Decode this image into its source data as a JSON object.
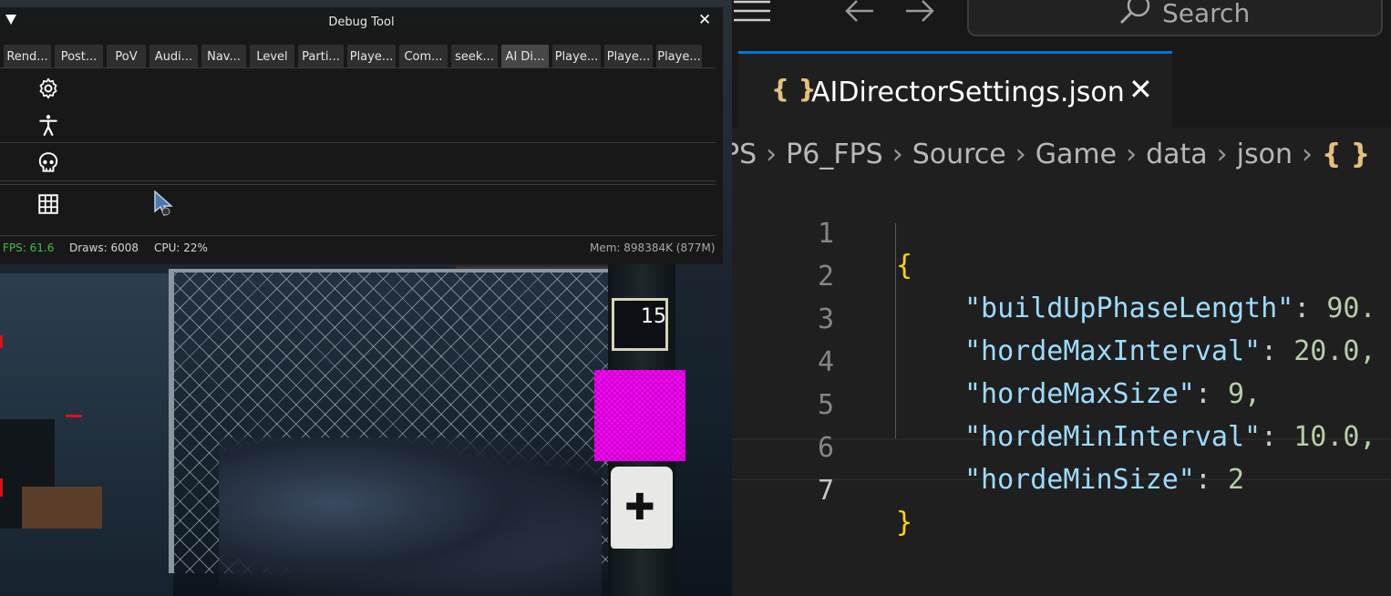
{
  "debug_tool": {
    "title": "Debug Tool",
    "close_glyph": "✕",
    "tabs": [
      {
        "label": "Rend..."
      },
      {
        "label": "Post..."
      },
      {
        "label": "PoV"
      },
      {
        "label": "Audi..."
      },
      {
        "label": "Nav..."
      },
      {
        "label": "Level"
      },
      {
        "label": "Parti..."
      },
      {
        "label": "Playe..."
      },
      {
        "label": "Com..."
      },
      {
        "label": "seek..."
      },
      {
        "label": "AI Di...",
        "active": true
      },
      {
        "label": "Playe..."
      },
      {
        "label": "Playe..."
      },
      {
        "label": "Playe..."
      }
    ],
    "side_icons": [
      "gear-icon",
      "person-icon",
      "skull-icon",
      "grid-icon"
    ],
    "status": {
      "fps": "FPS: 61.6",
      "draws": "Draws: 6008",
      "cpu": "CPU: 22%",
      "mem": "Mem: 898384K (877M)"
    },
    "colors": {
      "fps": "#3fbf3f",
      "panel": "#181818",
      "tab": "#2f2f2f",
      "tab_active": "#474747"
    }
  },
  "game": {
    "screen_value": "15"
  },
  "editor": {
    "search": {
      "placeholder": "Search"
    },
    "tab": {
      "filename": "AIDirectorSettings.json",
      "icon": "{ }",
      "close": "✕"
    },
    "breadcrumb": [
      "PS",
      "P6_FPS",
      "Source",
      "Game",
      "data",
      "json"
    ],
    "breadcrumb_icon": "{ }",
    "code_lines": [
      {
        "n": "1",
        "text": "{"
      },
      {
        "n": "2",
        "key": "\"buildUpPhaseLength\"",
        "value": "90."
      },
      {
        "n": "3",
        "key": "\"hordeMaxInterval\"",
        "value": "20.0,"
      },
      {
        "n": "4",
        "key": "\"hordeMaxSize\"",
        "value": "9,"
      },
      {
        "n": "5",
        "key": "\"hordeMinInterval\"",
        "value": "10.0,"
      },
      {
        "n": "6",
        "key": "\"hordeMinSize\"",
        "value": "2"
      },
      {
        "n": "7",
        "text": "}"
      }
    ],
    "colors": {
      "key": "#9cdcfe",
      "number": "#b5cea8",
      "brace": "#ffd700",
      "accent": "#0078d4"
    }
  }
}
